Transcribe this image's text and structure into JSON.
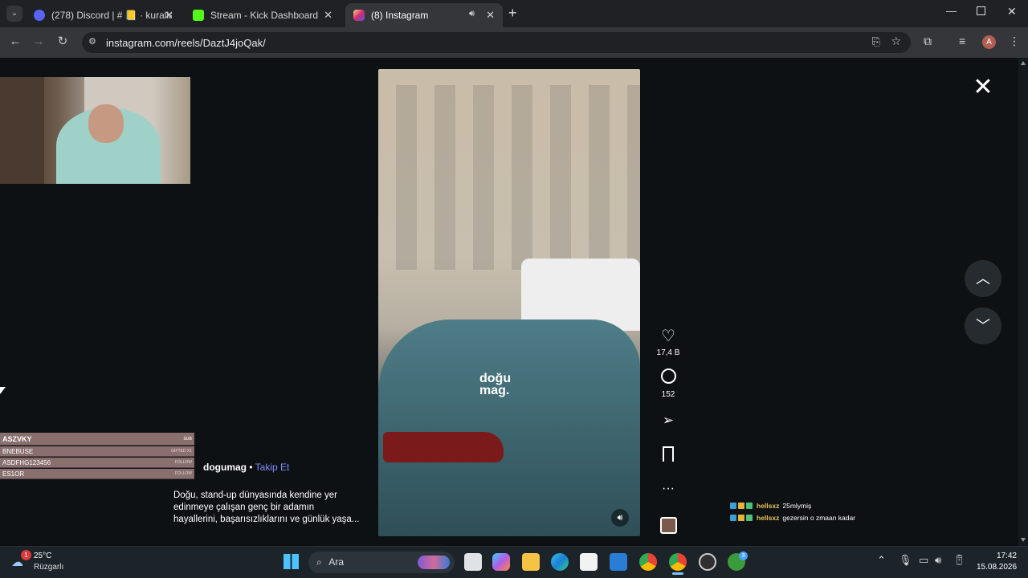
{
  "browser": {
    "tabs": [
      {
        "title": "(278) Discord | # 📒 · kurallar",
        "active": false,
        "icon_color": "#5865f2",
        "badge": "278"
      },
      {
        "title": "Stream - Kick Dashboard",
        "active": false,
        "icon_color": "#53fc18"
      },
      {
        "title": "(8) Instagram",
        "active": true,
        "icon_color": "#e1306c"
      }
    ],
    "url": "instagram.com/reels/DaztJ4joQak/",
    "profile_initial": "A"
  },
  "reel": {
    "watermark": "doğu mag.",
    "likes": "17,4 B",
    "comments": "152",
    "author": "dogumag",
    "follow_label": "Takip Et",
    "caption_lines": [
      "Doğu, stand-up dünyasında kendine yer",
      "edinmeye çalışan genç bir adamın",
      "hayallerini, başarısızlıklarını ve günlük yaşa..."
    ]
  },
  "stream_overlay": {
    "events": [
      {
        "name": "ASZVKY",
        "tag": "SUB"
      },
      {
        "name": "BNEBUSE",
        "tag": "GIFTED X1"
      },
      {
        "name": "ASDFHG123456",
        "tag": "FOLLOW"
      },
      {
        "name": "ES1OR",
        "tag": "FOLLOW"
      }
    ],
    "chat": [
      {
        "user": "hellsxz",
        "message": "25mlymiş"
      },
      {
        "user": "hellsxz",
        "message": "gezersin o zmaan kadar"
      }
    ]
  },
  "taskbar": {
    "weather_temp": "25°C",
    "weather_desc": "Rüzgarlı",
    "weather_badge": "1",
    "search_label": "Ara",
    "time": "17:42",
    "date": "15.08.2026",
    "xbox_badge": "3"
  }
}
